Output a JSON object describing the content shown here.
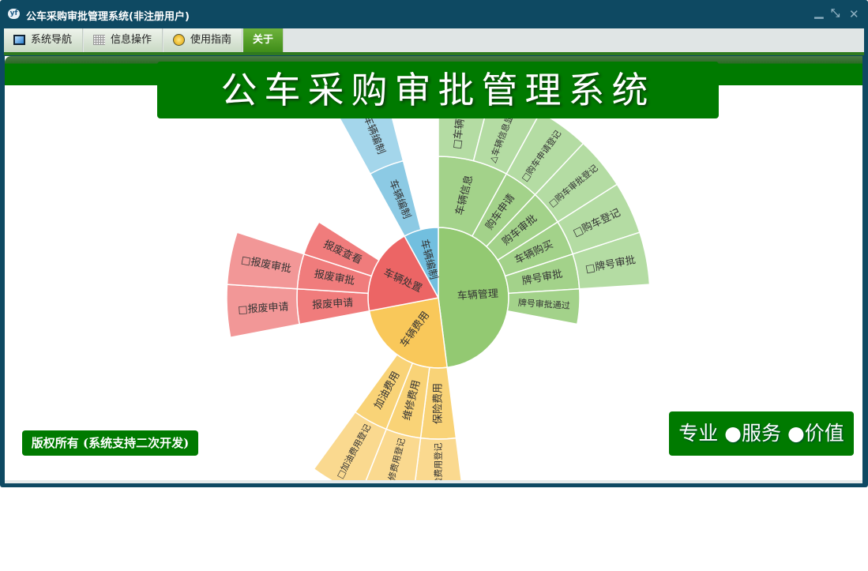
{
  "window": {
    "title": "公车采购审批管理系统(非注册用户)",
    "app_icon": "yf",
    "controls": {
      "minimize": "minimize-icon",
      "restore": "restore-icon",
      "close": "close-icon"
    }
  },
  "tabs": [
    {
      "label": "系统导航",
      "icon": "monitor-icon",
      "active": false
    },
    {
      "label": "信息操作",
      "icon": "grid-icon",
      "active": false
    },
    {
      "label": "使用指南",
      "icon": "help-icon",
      "active": false
    },
    {
      "label": "关于",
      "icon": "",
      "active": true
    }
  ],
  "banner": {
    "title": "公车采购审批管理系统"
  },
  "footer": {
    "copyright": "版权所有 (系统支持二次开发)",
    "slogan": "专业 ●服务 ●价值"
  },
  "colors": {
    "titlebar": "#0e4962",
    "brand_green": "#007a00"
  },
  "chart_data": {
    "type": "sunburst",
    "title": "",
    "start": "top",
    "direction": "clockwise",
    "nodes": [
      {
        "name": "车辆管理",
        "value": 12,
        "colors": [
          "#93c972",
          "#a3d28a",
          "#b4dca3"
        ],
        "children": [
          {
            "name": "车辆信息",
            "value": 2,
            "children": [
              {
                "name": "□车辆信息",
                "value": 1
              },
              {
                "name": "△车辆信息显示",
                "value": 1
              }
            ]
          },
          {
            "name": "购车申请",
            "value": 1,
            "children": [
              {
                "name": "□购车申请登记",
                "value": 1
              }
            ]
          },
          {
            "name": "购车审批",
            "value": 1,
            "children": [
              {
                "name": "□购车审批登记",
                "value": 1
              }
            ]
          },
          {
            "name": "车辆购买",
            "value": 1,
            "children": [
              {
                "name": "□购车登记",
                "value": 1
              }
            ]
          },
          {
            "name": "牌号审批",
            "value": 1,
            "children": [
              {
                "name": "□牌号审批",
                "value": 1
              }
            ]
          },
          {
            "name": "牌号审批通过",
            "value": 1
          }
        ]
      },
      {
        "name": "车辆费用",
        "value": 6,
        "colors": [
          "#f9c85a",
          "#f9d377",
          "#fad98f"
        ],
        "children": [
          {
            "name": "保险费用",
            "value": 1,
            "children": [
              {
                "name": "□保险费用登记",
                "value": 1
              }
            ]
          },
          {
            "name": "维修费用",
            "value": 1,
            "children": [
              {
                "name": "□维修费用登记",
                "value": 1
              }
            ]
          },
          {
            "name": "加油费用",
            "value": 1,
            "children": [
              {
                "name": "□加油费用登记",
                "value": 1
              }
            ]
          }
        ]
      },
      {
        "name": "车辆处置",
        "value": 5,
        "colors": [
          "#ec6565",
          "#f07c7c",
          "#f29797"
        ],
        "children": [
          {
            "name": "报废申请",
            "value": 1,
            "children": [
              {
                "name": "□报废申请",
                "value": 1
              }
            ]
          },
          {
            "name": "报废审批",
            "value": 1,
            "children": [
              {
                "name": "□报废审批",
                "value": 1
              }
            ]
          },
          {
            "name": "报废查看",
            "value": 1
          }
        ]
      },
      {
        "name": "车辆编制",
        "value": 2,
        "colors": [
          "#72bfdf",
          "#8ccae4",
          "#a4d6eb"
        ],
        "children": [
          {
            "name": "车辆编制",
            "value": 1,
            "children": [
              {
                "name": "车辆编制",
                "value": 1
              }
            ]
          }
        ]
      }
    ]
  }
}
